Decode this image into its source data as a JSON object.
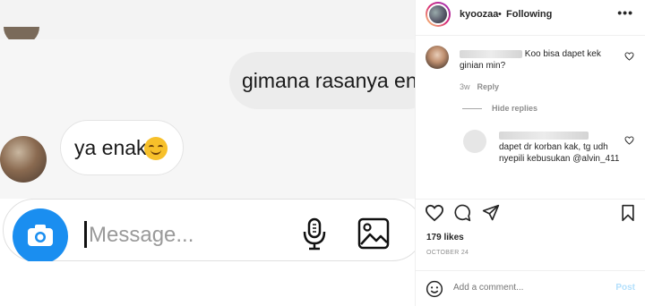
{
  "post_image": {
    "bubble_outgoing_text": "gimana rasanya enak",
    "bubble_incoming_text": "ya enak",
    "composer_placeholder": "Message..."
  },
  "header": {
    "username": "kyoozaa",
    "separator": "•",
    "follow_label": "Following",
    "more_label": "•••"
  },
  "comment": {
    "text_suffix": "Koo bisa dapet kek ginian min?",
    "age": "3w",
    "reply_label": "Reply"
  },
  "replies": {
    "toggle_label": "Hide replies",
    "items": [
      {
        "text": "dapet dr korban kak, tg udh nyepili kebusukan @alvin_411"
      }
    ]
  },
  "likes_text": "179 likes",
  "date_text": "OCTOBER 24",
  "add_comment": {
    "placeholder": "Add a comment...",
    "post_label": "Post"
  },
  "colors": {
    "camera_button": "#1a8ef0",
    "post_button_disabled": "#b2dffc"
  }
}
